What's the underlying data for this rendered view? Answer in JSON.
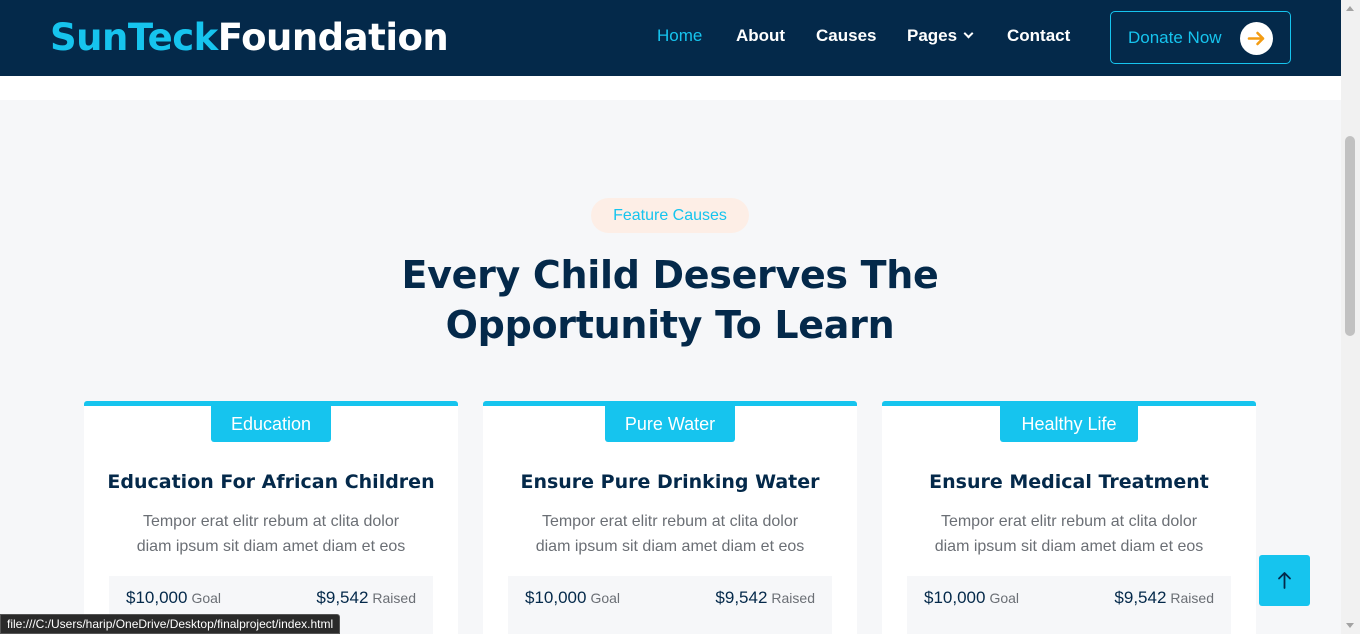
{
  "nav": {
    "brand_part1": "SunTeck",
    "brand_part2": "Foundation",
    "links": {
      "home": "Home",
      "about": "About",
      "causes": "Causes",
      "pages": "Pages",
      "contact": "Contact"
    },
    "donate_label": "Donate Now"
  },
  "section": {
    "eyebrow": "Feature Causes",
    "heading_line1": "Every Child Deserves The",
    "heading_line2": "Opportunity To Learn"
  },
  "cards": [
    {
      "tag": "Education",
      "title": "Education For African Children",
      "text_line1": "Tempor erat elitr rebum at clita dolor",
      "text_line2": "diam ipsum sit diam amet diam et eos",
      "goal_amount": "$10,000",
      "goal_label": "Goal",
      "raised_amount": "$9,542",
      "raised_label": "Raised"
    },
    {
      "tag": "Pure Water",
      "title": "Ensure Pure Drinking Water",
      "text_line1": "Tempor erat elitr rebum at clita dolor",
      "text_line2": "diam ipsum sit diam amet diam et eos",
      "goal_amount": "$10,000",
      "goal_label": "Goal",
      "raised_amount": "$9,542",
      "raised_label": "Raised"
    },
    {
      "tag": "Healthy Life",
      "title": "Ensure Medical Treatment",
      "text_line1": "Tempor erat elitr rebum at clita dolor",
      "text_line2": "diam ipsum sit diam amet diam et eos",
      "goal_amount": "$10,000",
      "goal_label": "Goal",
      "raised_amount": "$9,542",
      "raised_label": "Raised"
    }
  ],
  "status_url": "file:///C:/Users/harip/OneDrive/Desktop/finalproject/index.html",
  "icons": {
    "donate": "arrow-right-icon",
    "back_to_top": "arrow-up-icon",
    "pages_dropdown": "chevron-down-icon"
  },
  "colors": {
    "navbar": "#04294a",
    "accent": "#16c4ee",
    "section_bg": "#f6f7f9",
    "pill_bg": "#fdeee6",
    "donate_arrow": "#f39c12"
  }
}
